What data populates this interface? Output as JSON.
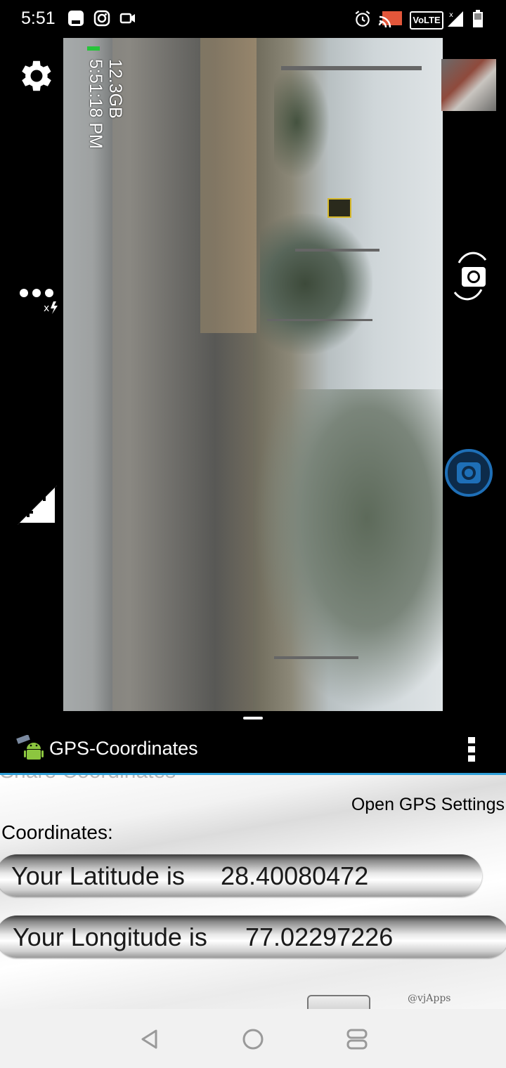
{
  "status_bar": {
    "time": "5:51",
    "left_icons": [
      "app-icon",
      "instagram-icon",
      "video-icon"
    ],
    "right_icons": [
      "alarm-icon",
      "cast-icon",
      "volte-badge",
      "signal-icon",
      "battery-icon"
    ],
    "volte_label": "VoLTE"
  },
  "camera": {
    "storage": "12.3GB",
    "timestamp": "5:51:18 PM",
    "buttons": [
      "settings",
      "more",
      "exposure",
      "switch-camera",
      "shutter"
    ]
  },
  "app_bar": {
    "title": "GPS-Coordinates",
    "menu_icon": "overflow-menu-icon"
  },
  "gps": {
    "share_label": "Share Coordinates",
    "open_gps_settings": "Open GPS Settings",
    "coordinates_label": "Coordinates:",
    "latitude_label": "Your Latitude is",
    "latitude_value": "28.40080472",
    "longitude_label": "Your Longitude is",
    "longitude_value": "77.02297226",
    "credit": "@vjApps"
  },
  "nav_bar": {
    "buttons": [
      "back",
      "home",
      "recents"
    ]
  },
  "colors": {
    "accent_line": "#2f9fd8",
    "shutter_blue": "#1e6fb7"
  }
}
